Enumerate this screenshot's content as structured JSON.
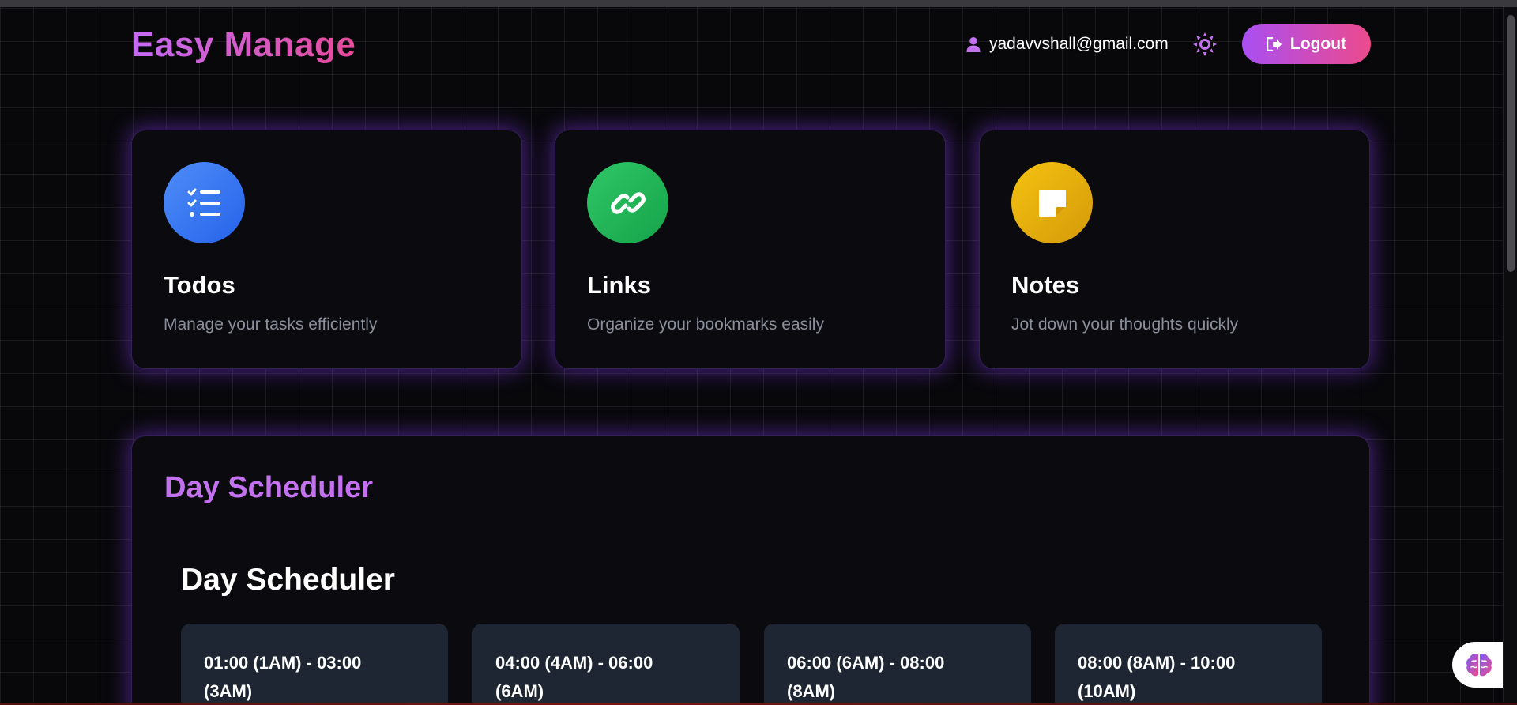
{
  "brand": {
    "name": "Easy Manage"
  },
  "header": {
    "user_email": "yadavvshall@gmail.com",
    "logout_label": "Logout"
  },
  "cards": [
    {
      "title": "Todos",
      "description": "Manage your tasks efficiently",
      "icon": "list-check-icon",
      "color": "#3b7ef6"
    },
    {
      "title": "Links",
      "description": "Organize your bookmarks easily",
      "icon": "link-icon",
      "color": "#22b455"
    },
    {
      "title": "Notes",
      "description": "Jot down your thoughts quickly",
      "icon": "sticky-note-icon",
      "color": "#e6a90b"
    }
  ],
  "scheduler": {
    "section_title": "Day Scheduler",
    "inner_title": "Day Scheduler",
    "slots": [
      {
        "line1": "01:00 (1AM) - 03:00",
        "line2": "(3AM)"
      },
      {
        "line1": "04:00 (4AM) - 06:00",
        "line2": "(6AM)"
      },
      {
        "line1": "06:00 (6AM) - 08:00",
        "line2": "(8AM)"
      },
      {
        "line1": "08:00 (8AM) - 10:00",
        "line2": "(10AM)"
      }
    ]
  },
  "colors": {
    "accent_purple": "#c471f0",
    "accent_pink": "#ec4a8c",
    "background": "#08080b",
    "slot_bg": "#1e2633"
  }
}
